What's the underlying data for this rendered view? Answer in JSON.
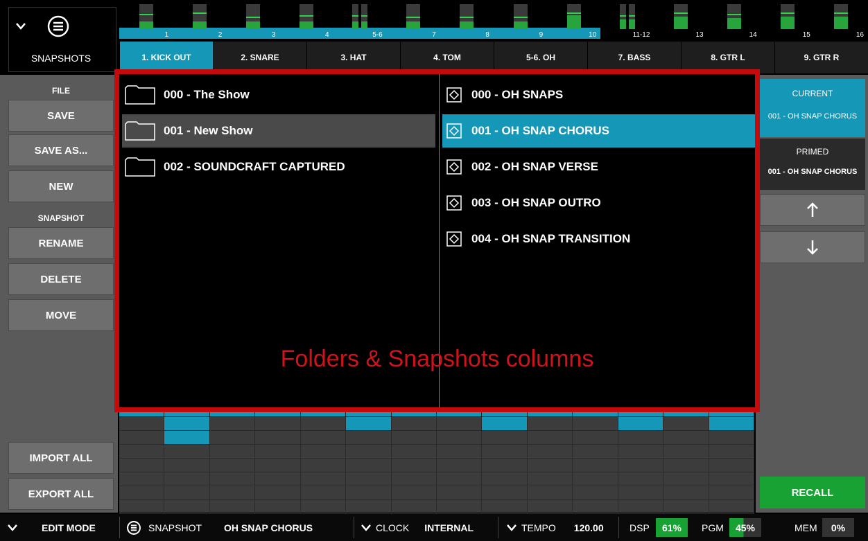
{
  "top_left": {
    "label": "SNAPSHOTS"
  },
  "meters": {
    "numbers": [
      "1",
      "2",
      "3",
      "4",
      "5-6",
      "7",
      "8",
      "9",
      "10",
      "11-12",
      "13",
      "14",
      "15",
      "16"
    ],
    "active_count": 9
  },
  "tabs": [
    "1. KICK OUT",
    "2. SNARE",
    "3. HAT",
    "4. TOM",
    "5-6. OH",
    "7. BASS",
    "8. GTR L",
    "9. GTR R"
  ],
  "sidebar": {
    "file_heading": "FILE",
    "save": "SAVE",
    "save_as": "SAVE AS...",
    "new": "NEW",
    "snapshot_heading": "SNAPSHOT",
    "rename": "RENAME",
    "delete": "DELETE",
    "move": "MOVE",
    "import_all": "IMPORT ALL",
    "export_all": "EXPORT ALL"
  },
  "browser": {
    "folders": [
      {
        "name": "000 - The Show",
        "selected": false
      },
      {
        "name": "001 - New Show",
        "selected": true
      },
      {
        "name": "002 - SOUNDCRAFT CAPTURED",
        "selected": false
      }
    ],
    "snapshots": [
      {
        "name": "000 - OH SNAPS",
        "selected": false
      },
      {
        "name": "001 - OH SNAP CHORUS",
        "selected": true
      },
      {
        "name": "002 - OH SNAP VERSE",
        "selected": false
      },
      {
        "name": "003 - OH SNAP OUTRO",
        "selected": false
      },
      {
        "name": "004 - OH SNAP TRANSITION",
        "selected": false
      }
    ],
    "caption": "Folders & Snapshots columns"
  },
  "rightbar": {
    "current_label": "CURRENT",
    "current_value": "001 - OH SNAP CHORUS",
    "primed_label": "PRIMED",
    "primed_value": "001 - OH SNAP CHORUS",
    "up_icon": "arrow-up-icon",
    "down_icon": "arrow-down-icon",
    "recall": "RECALL"
  },
  "status": {
    "edit_mode": "EDIT MODE",
    "snapshot_label": "SNAPSHOT",
    "snapshot_value": "OH SNAP CHORUS",
    "clock_label": "CLOCK",
    "clock_value": "INTERNAL",
    "tempo_label": "TEMPO",
    "tempo_value": "120.00",
    "dsp_label": "DSP",
    "dsp_value": "61%",
    "pgm_label": "PGM",
    "pgm_value": "45%",
    "mem_label": "MEM",
    "mem_value": "0%"
  },
  "colors": {
    "accent_blue": "#1597b7",
    "recall_green": "#17a233",
    "meter_green": "#27a43b",
    "highlight_red": "#c40a0a"
  }
}
